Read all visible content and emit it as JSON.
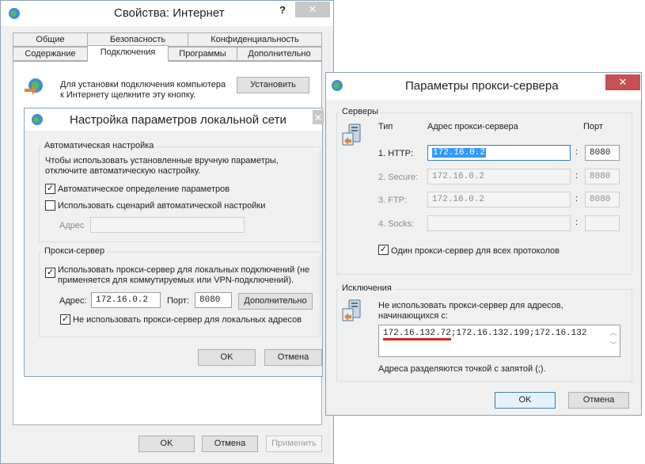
{
  "inet": {
    "title": "Свойства: Интернет",
    "help": "?",
    "close": "✕",
    "tabs_row1": [
      "Общие",
      "Безопасность",
      "Конфиденциальность"
    ],
    "tabs_row2": [
      "Содержание",
      "Подключения",
      "Программы",
      "Дополнительно"
    ],
    "setup_text_1": "Для установки подключения компьютера",
    "setup_text_2": "к Интернету щелкните эту кнопку.",
    "setup_button": "Установить",
    "ok": "OK",
    "cancel": "Отмена",
    "apply": "Применить"
  },
  "lan": {
    "title": "Настройка параметров локальной сети",
    "close": "✕",
    "auto_group": "Автоматическая настройка",
    "auto_desc_1": "Чтобы использовать установленные вручную параметры,",
    "auto_desc_2": "отключите автоматическую настройку.",
    "auto_detect_label": "Автоматическое определение параметров",
    "auto_detect_checked": true,
    "script_label": "Использовать сценарий автоматической настройки",
    "script_checked": false,
    "address_label": "Адрес",
    "address_value": "",
    "proxy_group": "Прокси-сервер",
    "use_proxy_1": "Использовать прокси-сервер для локальных подключений (не",
    "use_proxy_2": "применяется для коммутируемых или VPN-подключений).",
    "use_proxy_checked": true,
    "proxy_address_label": "Адрес:",
    "proxy_address_value": "172.16.0.2",
    "proxy_port_label": "Порт:",
    "proxy_port_value": "8080",
    "advanced_button": "Дополнительно",
    "bypass_local_label": "Не использовать прокси-сервер для локальных адресов",
    "bypass_local_checked": true,
    "ok": "OK",
    "cancel": "Отмена"
  },
  "proxy": {
    "title": "Параметры прокси-сервера",
    "close": "✕",
    "servers_group": "Серверы",
    "col_type": "Тип",
    "col_address": "Адрес прокси-сервера",
    "col_port": "Порт",
    "rows": [
      {
        "label": "1. HTTP:",
        "address": "172.16.0.2",
        "port": "8080",
        "enabled": true
      },
      {
        "label": "2. Secure:",
        "address": "172.16.0.2",
        "port": "8080",
        "enabled": false
      },
      {
        "label": "3. FTP:",
        "address": "172.16.0.2",
        "port": "8080",
        "enabled": false
      },
      {
        "label": "4. Socks:",
        "address": "",
        "port": "",
        "enabled": false
      }
    ],
    "colon": ":",
    "same_proxy_label": "Один прокси-сервер для всех протоколов",
    "same_proxy_checked": true,
    "exceptions_group": "Исключения",
    "exceptions_desc_1": "Не использовать прокси-сервер для адресов,",
    "exceptions_desc_2": "начинающихся с:",
    "exceptions_value_first": "172.16.132.72",
    "exceptions_value_rest": ";172.16.132.199;172.16.132",
    "exceptions_hint": "Адреса разделяются точкой с запятой (;).",
    "ok": "OK",
    "cancel": "Отмена"
  },
  "colors": {
    "close_red": "#c75050",
    "selection_blue": "#3399ff",
    "underline_red": "#e02020"
  }
}
